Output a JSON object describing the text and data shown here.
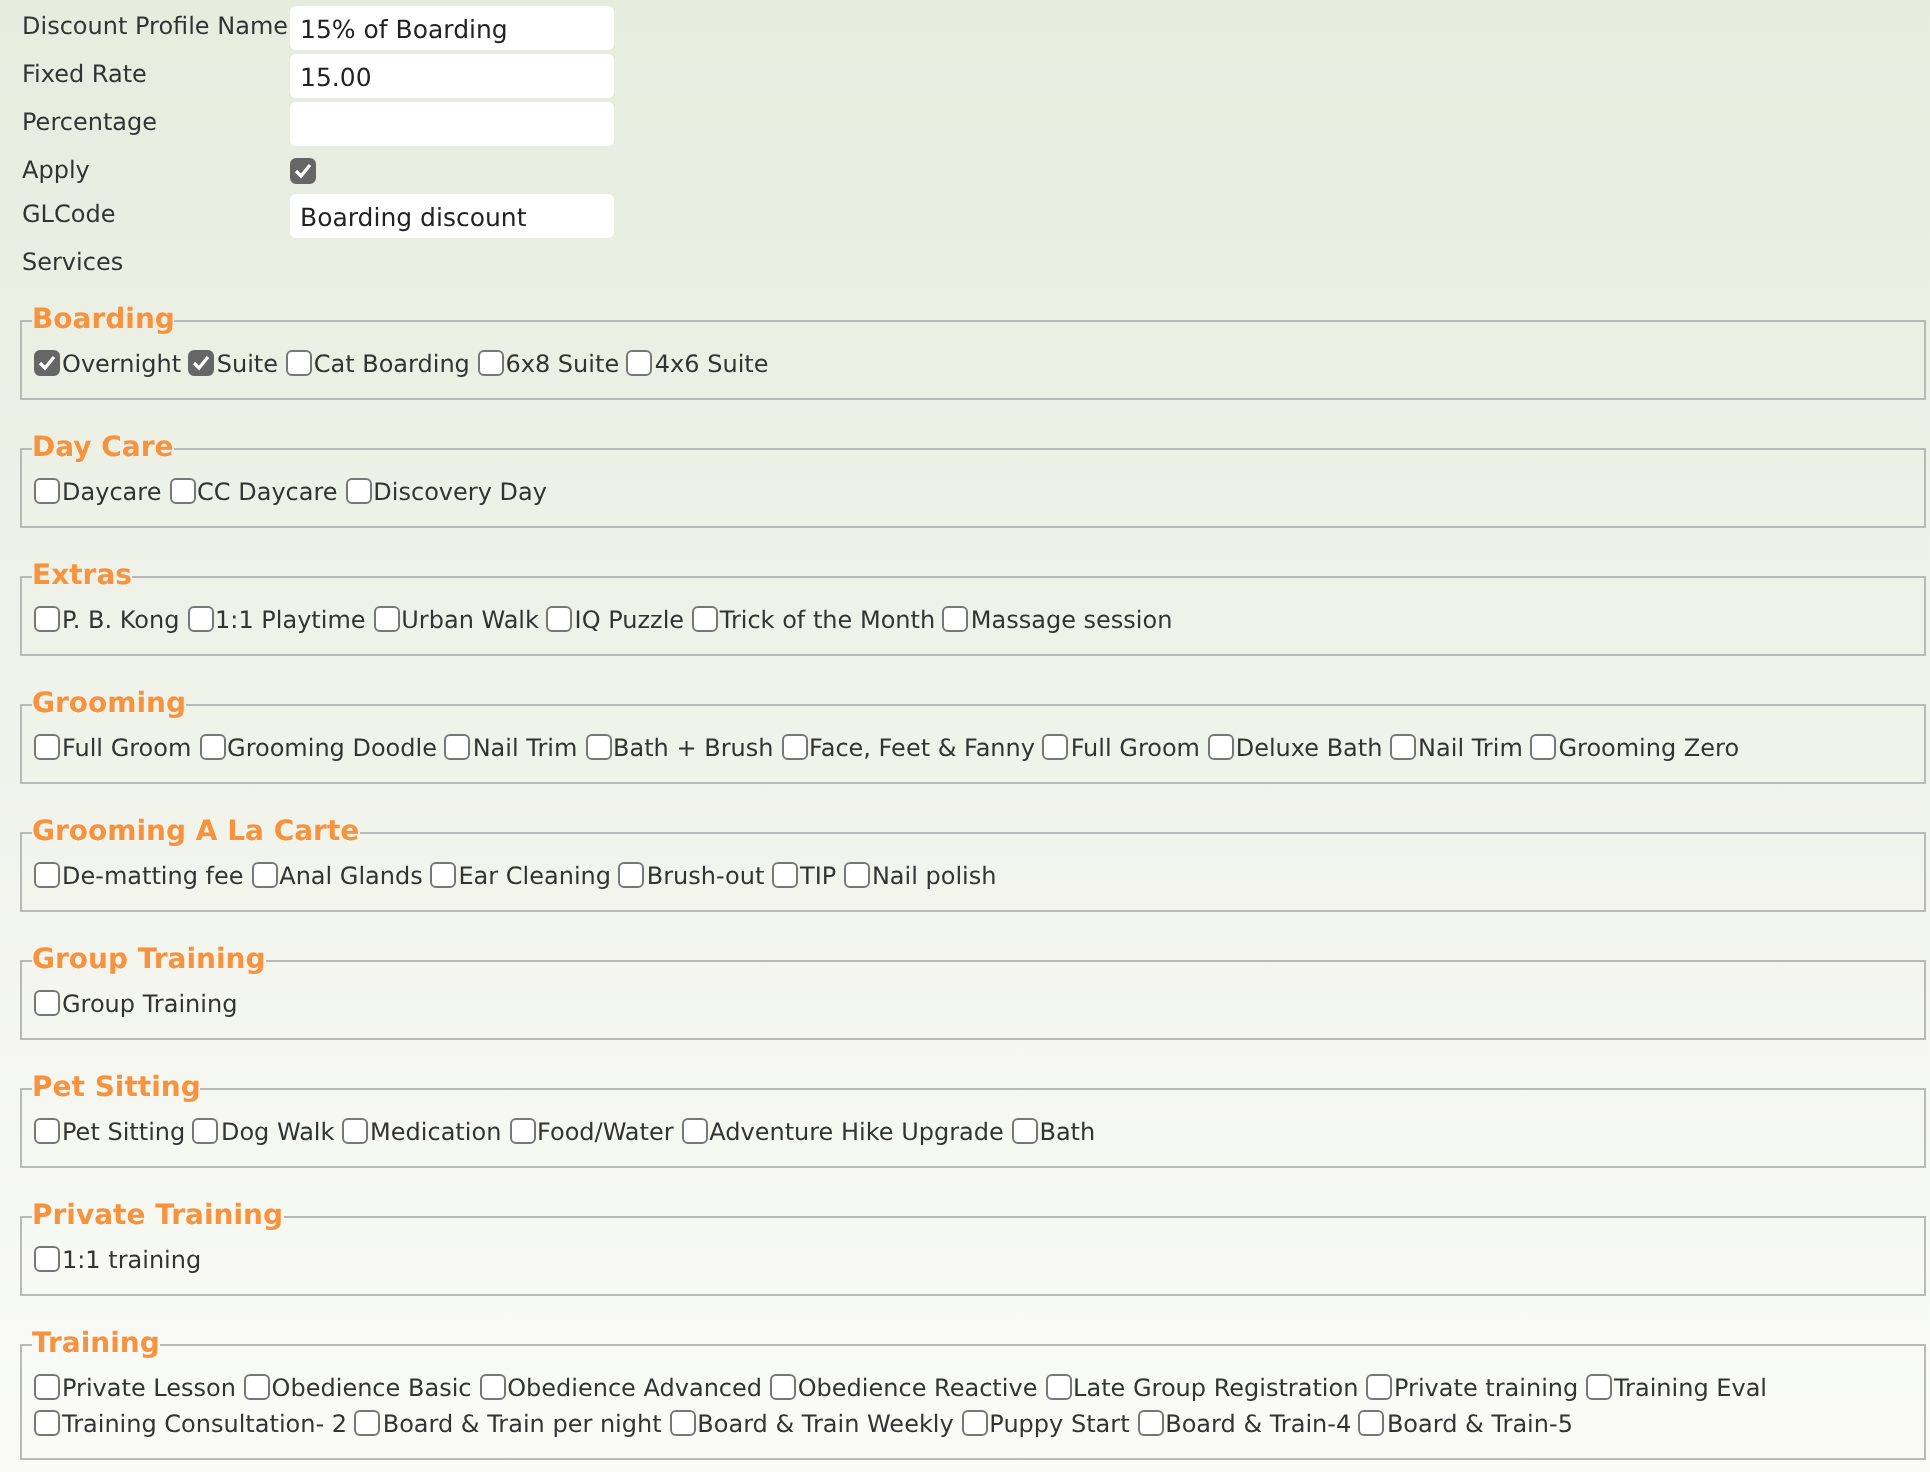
{
  "form": {
    "fields": [
      {
        "label": "Discount Profile Name",
        "kind": "text",
        "value": "15% of Boarding"
      },
      {
        "label": "Fixed Rate",
        "kind": "text",
        "value": "15.00"
      },
      {
        "label": "Percentage",
        "kind": "text"
      },
      {
        "label": "Apply",
        "kind": "checkbox",
        "checked": true
      },
      {
        "label": "GLCode",
        "kind": "text",
        "value": "Boarding discount"
      },
      {
        "label": "Services",
        "kind": "heading"
      }
    ]
  },
  "groups": [
    {
      "title": "Boarding",
      "services": [
        {
          "label": "Overnight",
          "checked": true
        },
        {
          "label": "Suite",
          "checked": true
        },
        {
          "label": "Cat Boarding",
          "checked": false
        },
        {
          "label": "6x8 Suite",
          "checked": false
        },
        {
          "label": "4x6 Suite",
          "checked": false
        }
      ]
    },
    {
      "title": "Day Care",
      "services": [
        {
          "label": "Daycare",
          "checked": false
        },
        {
          "label": "CC Daycare",
          "checked": false
        },
        {
          "label": "Discovery Day",
          "checked": false
        }
      ]
    },
    {
      "title": "Extras",
      "services": [
        {
          "label": "P. B. Kong",
          "checked": false
        },
        {
          "label": "1:1 Playtime",
          "checked": false
        },
        {
          "label": "Urban Walk",
          "checked": false
        },
        {
          "label": "IQ Puzzle",
          "checked": false
        },
        {
          "label": "Trick of the Month",
          "checked": false
        },
        {
          "label": "Massage session",
          "checked": false
        }
      ]
    },
    {
      "title": "Grooming",
      "services": [
        {
          "label": "Full Groom",
          "checked": false
        },
        {
          "label": "Grooming Doodle",
          "checked": false
        },
        {
          "label": "Nail Trim",
          "checked": false
        },
        {
          "label": "Bath + Brush",
          "checked": false
        },
        {
          "label": "Face, Feet & Fanny",
          "checked": false
        },
        {
          "label": "Full Groom",
          "checked": false
        },
        {
          "label": "Deluxe Bath",
          "checked": false
        },
        {
          "label": "Nail Trim",
          "checked": false
        },
        {
          "label": "Grooming Zero",
          "checked": false
        }
      ]
    },
    {
      "title": "Grooming A La Carte",
      "services": [
        {
          "label": "De-matting fee",
          "checked": false
        },
        {
          "label": "Anal Glands",
          "checked": false
        },
        {
          "label": "Ear Cleaning",
          "checked": false
        },
        {
          "label": "Brush-out",
          "checked": false
        },
        {
          "label": "TIP",
          "checked": false
        },
        {
          "label": "Nail polish",
          "checked": false
        }
      ]
    },
    {
      "title": "Group Training",
      "services": [
        {
          "label": "Group Training",
          "checked": false
        }
      ]
    },
    {
      "title": "Pet Sitting",
      "services": [
        {
          "label": "Pet Sitting",
          "checked": false
        },
        {
          "label": "Dog Walk",
          "checked": false
        },
        {
          "label": "Medication",
          "checked": false
        },
        {
          "label": "Food/Water",
          "checked": false
        },
        {
          "label": "Adventure Hike Upgrade",
          "checked": false
        },
        {
          "label": "Bath",
          "checked": false
        }
      ]
    },
    {
      "title": "Private Training",
      "services": [
        {
          "label": "1:1 training",
          "checked": false
        }
      ]
    },
    {
      "title": "Training",
      "services": [
        {
          "label": "Private Lesson",
          "checked": false
        },
        {
          "label": "Obedience Basic",
          "checked": false
        },
        {
          "label": "Obedience Advanced",
          "checked": false
        },
        {
          "label": "Obedience Reactive",
          "checked": false
        },
        {
          "label": "Late Group Registration",
          "checked": false
        },
        {
          "label": "Private training",
          "checked": false
        },
        {
          "label": "Training Eval",
          "checked": false
        },
        {
          "label": "Training Consultation- 2",
          "checked": false
        },
        {
          "label": "Board & Train per night",
          "checked": false
        },
        {
          "label": "Board & Train Weekly",
          "checked": false
        },
        {
          "label": "Puppy Start",
          "checked": false
        },
        {
          "label": "Board & Train-4",
          "checked": false
        },
        {
          "label": "Board & Train-5",
          "checked": false
        }
      ]
    }
  ]
}
